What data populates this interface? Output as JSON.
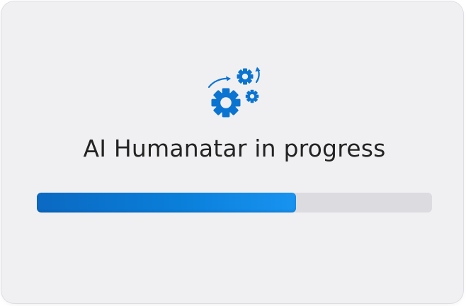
{
  "status": {
    "title": "AI Humanatar in progress",
    "icon": "gears-icon",
    "progress": 0.656,
    "accent_color": "#0a7fda",
    "track_color": "#dcdce0"
  }
}
